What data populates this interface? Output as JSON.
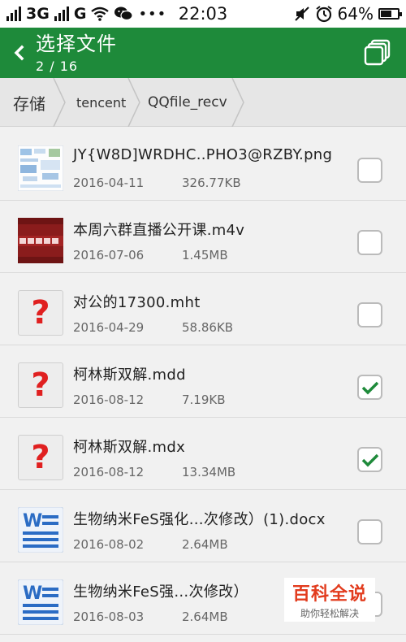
{
  "status_bar": {
    "network_1": "3G",
    "network_2": "G",
    "time": "22:03",
    "battery": "64%",
    "battery_level": 0.64
  },
  "header": {
    "title": "选择文件",
    "counter": "2 / 16",
    "color": "#1e8a3a"
  },
  "breadcrumb": [
    "存储",
    "tencent",
    "QQfile_recv"
  ],
  "files": [
    {
      "name": "JY{W8D]WRDHC..PHO3@RZBY.png",
      "date": "2016-04-11",
      "size": "326.77KB",
      "icon": "image-thumbnail",
      "checked": false
    },
    {
      "name": "本周六群直播公开课.m4v",
      "date": "2016-07-06",
      "size": "1.45MB",
      "icon": "video-thumbnail",
      "checked": false
    },
    {
      "name": "对公的17300.mht",
      "date": "2016-04-29",
      "size": "58.86KB",
      "icon": "unknown-file-icon",
      "checked": false
    },
    {
      "name": "柯林斯双解.mdd",
      "date": "2016-08-12",
      "size": "7.19KB",
      "icon": "unknown-file-icon",
      "checked": true
    },
    {
      "name": "柯林斯双解.mdx",
      "date": "2016-08-12",
      "size": "13.34MB",
      "icon": "unknown-file-icon",
      "checked": true
    },
    {
      "name": "生物纳米FeS强化…次修改）(1).docx",
      "date": "2016-08-02",
      "size": "2.64MB",
      "icon": "word-doc-icon",
      "checked": false
    },
    {
      "name": "生物纳米FeS强…次修改）",
      "date": "2016-08-03",
      "size": "2.64MB",
      "icon": "word-doc-icon",
      "checked": false
    }
  ],
  "watermark": {
    "title": "百科全说",
    "subtitle": "助你轻松解决"
  }
}
